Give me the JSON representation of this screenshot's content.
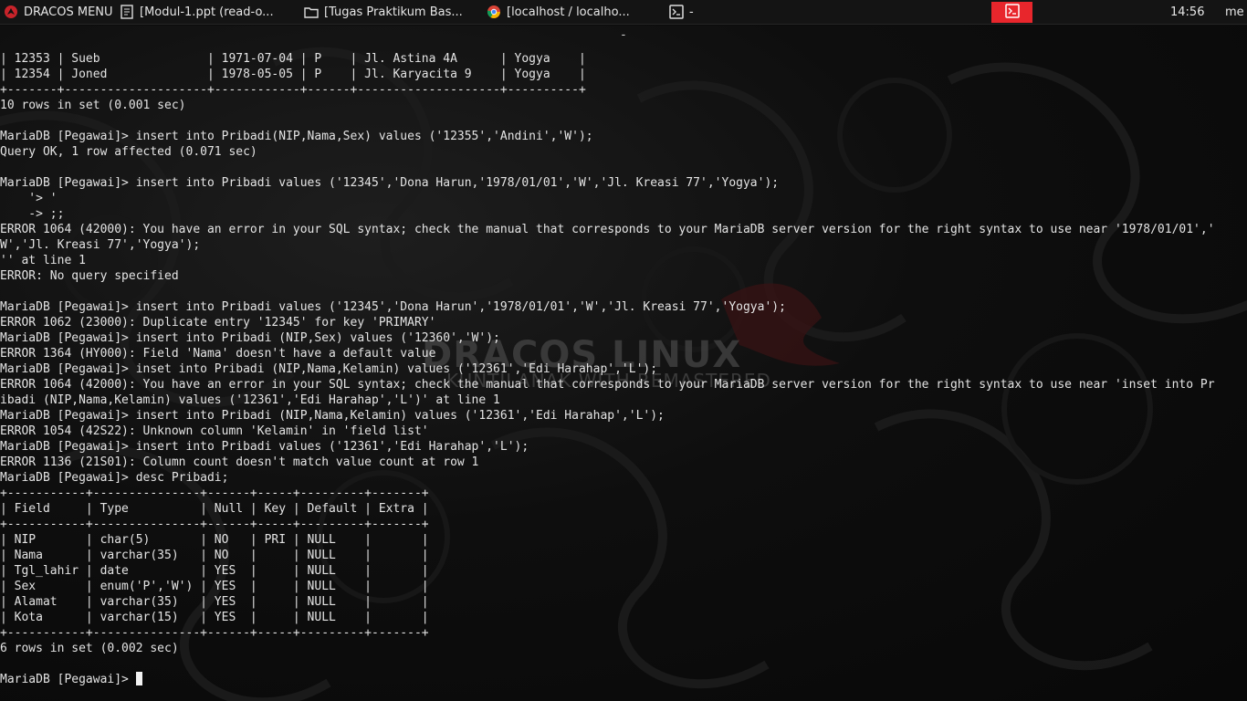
{
  "taskbar": {
    "menu_label": "DRACOS MENU",
    "tasks": [
      {
        "label": "[Modul-1.ppt (read-o...",
        "icon": "document-icon"
      },
      {
        "label": "[Tugas Praktikum Bas...",
        "icon": "folder-icon"
      },
      {
        "label": "[localhost / localho...",
        "icon": "chrome-icon"
      },
      {
        "label": "-",
        "icon": "terminal-icon"
      }
    ],
    "active_task_icon": "terminal-icon",
    "active_color": "#e8262c",
    "clock": "14:56",
    "user": "me"
  },
  "desktop": {
    "window_title": "-",
    "brand_title": "DRACOS LINUX",
    "brand_subtitle": "KUNTILANAK WITH REMASTERED"
  },
  "terminal": {
    "lines": [
      "| 12353 | Sueb               | 1971-07-04 | P    | Jl. Astina 4A      | Yogya    |",
      "| 12354 | Joned              | 1978-05-05 | P    | Jl. Karyacita 9    | Yogya    |",
      "+-------+--------------------+------------+------+--------------------+----------+",
      "10 rows in set (0.001 sec)",
      "",
      "MariaDB [Pegawai]> insert into Pribadi(NIP,Nama,Sex) values ('12355','Andini','W');",
      "Query OK, 1 row affected (0.071 sec)",
      "",
      "MariaDB [Pegawai]> insert into Pribadi values ('12345','Dona Harun,'1978/01/01','W','Jl. Kreasi 77','Yogya');",
      "    '> '",
      "    -> ;;",
      "ERROR 1064 (42000): You have an error in your SQL syntax; check the manual that corresponds to your MariaDB server version for the right syntax to use near '1978/01/01','",
      "W','Jl. Kreasi 77','Yogya');",
      "'' at line 1",
      "ERROR: No query specified",
      "",
      "MariaDB [Pegawai]> insert into Pribadi values ('12345','Dona Harun','1978/01/01','W','Jl. Kreasi 77','Yogya');",
      "ERROR 1062 (23000): Duplicate entry '12345' for key 'PRIMARY'",
      "MariaDB [Pegawai]> insert into Pribadi (NIP,Sex) values ('12360','W');",
      "ERROR 1364 (HY000): Field 'Nama' doesn't have a default value",
      "MariaDB [Pegawai]> inset into Pribadi (NIP,Nama,Kelamin) values ('12361','Edi Harahap','L');",
      "ERROR 1064 (42000): You have an error in your SQL syntax; check the manual that corresponds to your MariaDB server version for the right syntax to use near 'inset into Pr",
      "ibadi (NIP,Nama,Kelamin) values ('12361','Edi Harahap','L')' at line 1",
      "MariaDB [Pegawai]> insert into Pribadi (NIP,Nama,Kelamin) values ('12361','Edi Harahap','L');",
      "ERROR 1054 (42S22): Unknown column 'Kelamin' in 'field list'",
      "MariaDB [Pegawai]> insert into Pribadi values ('12361','Edi Harahap','L');",
      "ERROR 1136 (21S01): Column count doesn't match value count at row 1",
      "MariaDB [Pegawai]> desc Pribadi;",
      "+-----------+---------------+------+-----+---------+-------+",
      "| Field     | Type          | Null | Key | Default | Extra |",
      "+-----------+---------------+------+-----+---------+-------+",
      "| NIP       | char(5)       | NO   | PRI | NULL    |       |",
      "| Nama      | varchar(35)   | NO   |     | NULL    |       |",
      "| Tgl_lahir | date          | YES  |     | NULL    |       |",
      "| Sex       | enum('P','W') | YES  |     | NULL    |       |",
      "| Alamat    | varchar(35)   | YES  |     | NULL    |       |",
      "| Kota      | varchar(15)   | YES  |     | NULL    |       |",
      "+-----------+---------------+------+-----+---------+-------+",
      "6 rows in set (0.002 sec)",
      "",
      "MariaDB [Pegawai]> "
    ],
    "text_color": "#e4e4e4",
    "background": "#0b0b0b"
  }
}
